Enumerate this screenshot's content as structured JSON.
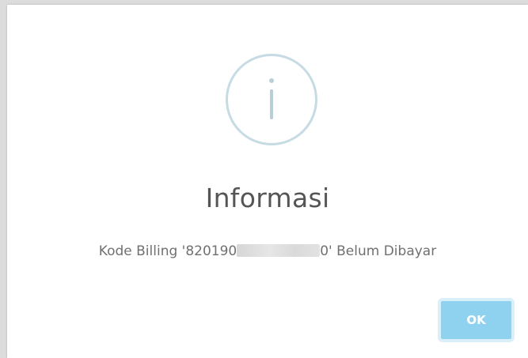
{
  "dialog": {
    "icon": "info-icon",
    "title": "Informasi",
    "message_prefix": "Kode Billing '820190",
    "message_suffix": "0' Belum Dibayar",
    "ok_label": "OK"
  },
  "colors": {
    "icon_outline": "#c6dbe3",
    "button_fill": "#8ed2f0",
    "title_text": "#555555"
  }
}
